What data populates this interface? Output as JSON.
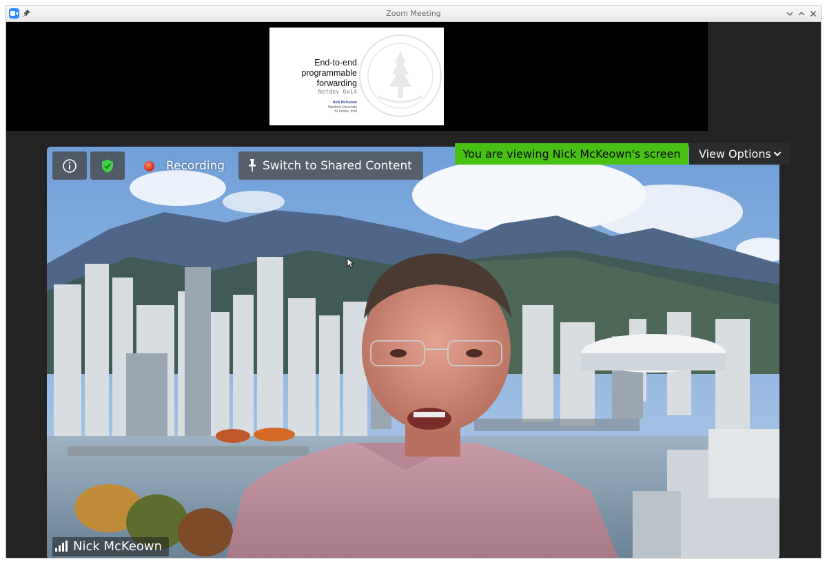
{
  "window": {
    "title": "Zoom Meeting"
  },
  "shared_screen": {
    "slide_title": "End-to-end\nprogrammable\nforwarding",
    "slide_subtitle": "Netdev 0x14",
    "author_name": "Nick McKeown",
    "author_line2": "Stanford University",
    "author_line3": "Sr Fellow, Intel"
  },
  "toolbar": {
    "info_icon": "info-icon",
    "security_icon": "shield-check-icon",
    "recording_label": "Recording",
    "switch_label": "Switch to Shared Content"
  },
  "banner": {
    "viewing_text": "You are viewing Nick McKeown's screen",
    "view_options_label": "View Options"
  },
  "participant": {
    "name": "Nick McKeown"
  },
  "colors": {
    "banner_green": "#48c014",
    "recording_red": "#d9311c",
    "shield_green": "#3dd24a",
    "zoom_blue": "#2d8cff"
  }
}
